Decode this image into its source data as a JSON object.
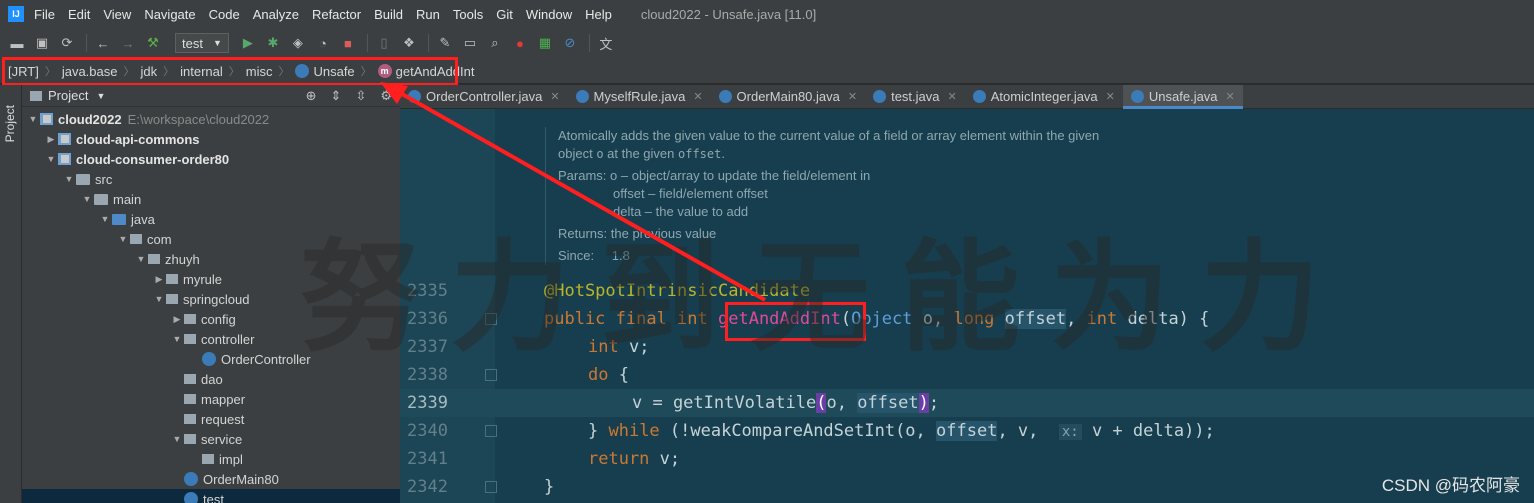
{
  "menubar": {
    "logo_text": "IJ",
    "items": [
      "File",
      "Edit",
      "View",
      "Navigate",
      "Code",
      "Analyze",
      "Refactor",
      "Build",
      "Run",
      "Tools",
      "Git",
      "Window",
      "Help"
    ],
    "window_title": "cloud2022 - Unsafe.java [11.0]"
  },
  "toolbar": {
    "run_config": "test",
    "icons": [
      "folder-open-icon",
      "save-icon",
      "sync-icon",
      "back-icon",
      "forward-icon",
      "build-hammer-icon",
      "run-icon",
      "debug-icon",
      "coverage-icon",
      "profile-icon",
      "stop-icon",
      "attach-icon",
      "project-structure-icon",
      "settings-wrench-icon",
      "terminal-icon",
      "search-icon",
      "codota-icon",
      "plugin-icon",
      "block-icon",
      "translate-icon"
    ]
  },
  "breadcrumb": {
    "items": [
      "[JRT]",
      "java.base",
      "jdk",
      "internal",
      "misc",
      "Unsafe",
      "getAndAddInt"
    ],
    "method_badge": "m"
  },
  "stripe": {
    "label": "Project"
  },
  "project_panel": {
    "title": "Project",
    "tree": [
      {
        "label": "cloud2022",
        "hint": "E:\\workspace\\cloud2022",
        "kind": "module",
        "bold": true
      },
      {
        "label": "cloud-api-commons",
        "kind": "module",
        "bold": true
      },
      {
        "label": "cloud-consumer-order80",
        "kind": "module",
        "bold": true
      },
      {
        "label": "src",
        "kind": "folder"
      },
      {
        "label": "main",
        "kind": "folder"
      },
      {
        "label": "java",
        "kind": "src"
      },
      {
        "label": "com",
        "kind": "pkg"
      },
      {
        "label": "zhuyh",
        "kind": "pkg"
      },
      {
        "label": "myrule",
        "kind": "pkg"
      },
      {
        "label": "springcloud",
        "kind": "pkg"
      },
      {
        "label": "config",
        "kind": "pkg"
      },
      {
        "label": "controller",
        "kind": "pkg"
      },
      {
        "label": "OrderController",
        "kind": "class"
      },
      {
        "label": "dao",
        "kind": "pkg"
      },
      {
        "label": "mapper",
        "kind": "pkg"
      },
      {
        "label": "request",
        "kind": "pkg"
      },
      {
        "label": "service",
        "kind": "pkg"
      },
      {
        "label": "impl",
        "kind": "pkg"
      },
      {
        "label": "OrderMain80",
        "kind": "class"
      },
      {
        "label": "test",
        "kind": "class"
      }
    ]
  },
  "tabs": [
    {
      "label": "OrderController.java",
      "active": false
    },
    {
      "label": "MyselfRule.java",
      "active": false
    },
    {
      "label": "OrderMain80.java",
      "active": false
    },
    {
      "label": "test.java",
      "active": false
    },
    {
      "label": "AtomicInteger.java",
      "active": false
    },
    {
      "label": "Unsafe.java",
      "active": true
    }
  ],
  "doc": {
    "line1": "Atomically adds the given value to the current value of a field or array element within the given",
    "line2_a": "object ",
    "line2_b": "o",
    "line2_c": " at the given ",
    "line2_d": "offset",
    "line2_e": ".",
    "params_label": "Params:",
    "param1": "o – object/array to update the field/element in",
    "param2": "offset – field/element offset",
    "param3": "delta – the value to add",
    "returns_label": "Returns:",
    "returns": "the previous value",
    "since_label": "Since:",
    "since": "1.8"
  },
  "code": {
    "line_numbers": [
      "2335",
      "2336",
      "2337",
      "2338",
      "2339",
      "2340",
      "2341",
      "2342"
    ],
    "annotation": "@HotSpotIntrinsicCandidate",
    "l2_kw": "public final int ",
    "l2_method": "getAndAddInt",
    "l2_paren": "(",
    "l2_type": "Object",
    "l2_a": " o, ",
    "l2_kw2": "long ",
    "l2_offset": "offset",
    "l2_b": ", ",
    "l2_kw3": "int ",
    "l2_c": "delta) {",
    "l3_kw": "int ",
    "l3_rest": "v;",
    "l4_kw": "do ",
    "l4_rest": "{",
    "l5_a": "v = getIntVolatile",
    "l5_open": "(",
    "l5_b": "o, ",
    "l5_offset": "offset",
    "l5_close": ")",
    "l5_end": ";",
    "l6_a": "} ",
    "l6_kw": "while ",
    "l6_b": "(!weakCompareAndSetInt(o, ",
    "l6_offset": "offset",
    "l6_c": ", v,  ",
    "l6_hint": "x:",
    "l6_d": " v + delta));",
    "l7_kw": "return ",
    "l7_rest": "v;",
    "l8": "}"
  },
  "watermark": "努力到无能为力",
  "credit": "CSDN @码农阿豪",
  "colors": {
    "highlight_box": "#ff1f1f",
    "editor_bg": "#173e4e",
    "accent": "#4a88c7"
  }
}
